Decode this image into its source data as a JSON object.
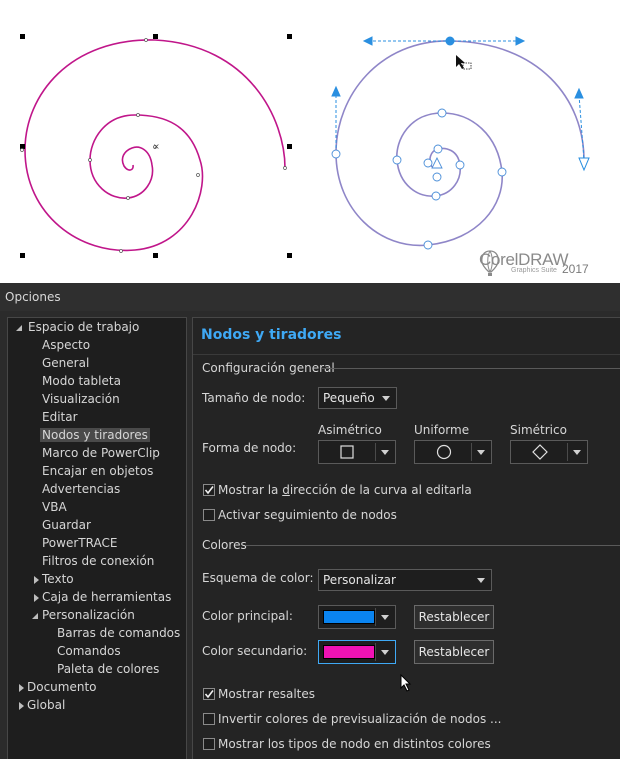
{
  "preview": {
    "logo_text": "CorelDRAW",
    "logo_sub": "Graphics Suite",
    "logo_year": "2017"
  },
  "dialog": {
    "title": "Opciones"
  },
  "tree": {
    "items": [
      {
        "label": "Espacio de trabajo",
        "level": 0,
        "state": "open"
      },
      {
        "label": "Aspecto",
        "level": 1
      },
      {
        "label": "General",
        "level": 1
      },
      {
        "label": "Modo tableta",
        "level": 1
      },
      {
        "label": "Visualización",
        "level": 1
      },
      {
        "label": "Editar",
        "level": 1
      },
      {
        "label": "Nodos y tiradores",
        "level": 1,
        "selected": true
      },
      {
        "label": "Marco de PowerClip",
        "level": 1
      },
      {
        "label": "Encajar en objetos",
        "level": 1
      },
      {
        "label": "Advertencias",
        "level": 1
      },
      {
        "label": "VBA",
        "level": 1
      },
      {
        "label": "Guardar",
        "level": 1
      },
      {
        "label": "PowerTRACE",
        "level": 1
      },
      {
        "label": "Filtros de conexión",
        "level": 1
      },
      {
        "label": "Texto",
        "level": 1,
        "state": "closed"
      },
      {
        "label": "Caja de herramientas",
        "level": 1,
        "state": "closed"
      },
      {
        "label": "Personalización",
        "level": 1,
        "state": "open"
      },
      {
        "label": "Barras de comandos",
        "level": 2
      },
      {
        "label": "Comandos",
        "level": 2
      },
      {
        "label": "Paleta de colores",
        "level": 2
      },
      {
        "label": "Documento",
        "level": 0,
        "state": "closed"
      },
      {
        "label": "Global",
        "level": 0,
        "state": "closed"
      }
    ]
  },
  "panel": {
    "heading": "Nodos y tiradores",
    "general_section": "Configuración general",
    "node_size_label": "Tamaño de nodo:",
    "node_size_value": "Pequeño",
    "node_shape_label": "Forma de nodo:",
    "shape_asym_label": "Asimétrico",
    "shape_uniform_label": "Uniforme",
    "shape_sym_label": "Simétrico",
    "show_direction": {
      "pre": "Mostrar la ",
      "accel": "d",
      "post": "irección de la curva al editarla",
      "checked": true
    },
    "node_tracking": {
      "label": "Activar seguimiento de nodos",
      "checked": false
    },
    "colors_section": "Colores",
    "color_scheme_label": "Esquema de color:",
    "color_scheme_value": "Personalizar",
    "primary_label": "Color principal:",
    "primary_color": "#0a84f0",
    "secondary_label": "Color secundario:",
    "secondary_color": "#f012b4",
    "reset_label": "Restablecer",
    "show_highlights": {
      "label": "Mostrar resaltes",
      "checked": true
    },
    "invert_colors": {
      "label": "Invertir colores de previsualización de nodos ...",
      "checked": false
    },
    "node_types_colors": {
      "label": "Mostrar los tipos de nodo en distintos colores",
      "checked": false
    }
  },
  "colors": {
    "accent": "#3fa9f5",
    "spiral_left": "#c0168a",
    "spiral_right": "#8f86c8"
  }
}
